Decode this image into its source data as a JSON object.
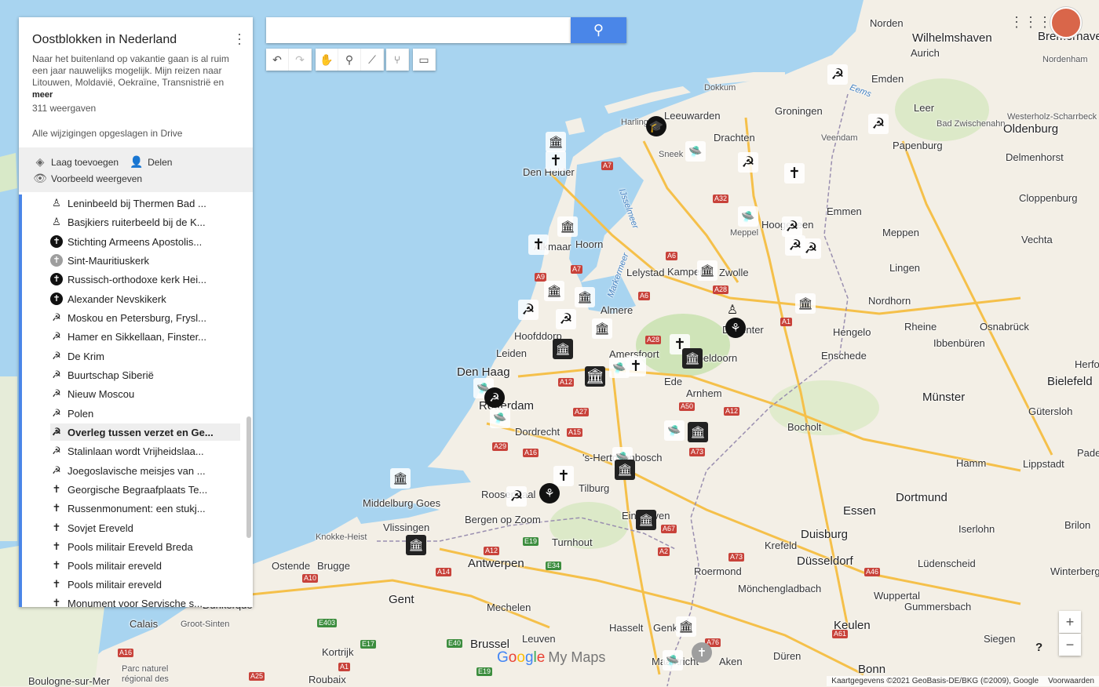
{
  "panel": {
    "title": "Oostblokken in Nederland",
    "description": "Naar het buitenland op vakantie gaan is al ruim een jaar nauwelijks mogelijk. Mijn reizen naar Litouwen, Moldavië, Oekraïne, Transnistrië en",
    "more": "meer",
    "views": "311 weergaven",
    "saved": "Alle wijzigingen opgeslagen in Drive",
    "add_layer": "Laag toevoegen",
    "share": "Delen",
    "preview": "Voorbeeld weergeven",
    "items": [
      {
        "label": "Leninbeeld bij Thermen Bad ...",
        "icon": "statue-icon"
      },
      {
        "label": "Basjkiers ruiterbeeld bij de K...",
        "icon": "statue-icon"
      },
      {
        "label": "Stichting Armeens Apostolis...",
        "icon": "church-cross-icon"
      },
      {
        "label": "Sint-Mauritiuskerk",
        "icon": "church-cross-grey-icon"
      },
      {
        "label": "Russisch-orthodoxe kerk Hei...",
        "icon": "church-cross-icon"
      },
      {
        "label": "Alexander Nevskikerk",
        "icon": "church-cross-icon"
      },
      {
        "label": "Moskou en Petersburg, Frysl...",
        "icon": "hammer-sickle-icon"
      },
      {
        "label": "Hamer en Sikkellaan, Finster...",
        "icon": "hammer-sickle-icon"
      },
      {
        "label": "De Krim",
        "icon": "hammer-sickle-icon"
      },
      {
        "label": "Buurtschap Siberië",
        "icon": "hammer-sickle-icon"
      },
      {
        "label": "Nieuw Moscou",
        "icon": "hammer-sickle-icon"
      },
      {
        "label": "Polen",
        "icon": "hammer-sickle-icon"
      },
      {
        "label": "Overleg tussen verzet en Ge...",
        "icon": "hammer-sickle-icon"
      },
      {
        "label": "Stalinlaan wordt Vrijheidslaa...",
        "icon": "hammer-sickle-icon"
      },
      {
        "label": "Joegoslavische meisjes van ...",
        "icon": "hammer-sickle-icon"
      },
      {
        "label": "Georgische Begraafplaats Te...",
        "icon": "cemetery-icon"
      },
      {
        "label": "Russenmonument: een stukj...",
        "icon": "cemetery-icon"
      },
      {
        "label": "Sovjet Ereveld",
        "icon": "cemetery-icon"
      },
      {
        "label": "Pools militair Ereveld Breda",
        "icon": "cemetery-icon"
      },
      {
        "label": "Pools militair ereveld",
        "icon": "cemetery-icon"
      },
      {
        "label": "Pools militair ereveld",
        "icon": "cemetery-icon"
      },
      {
        "label": "Monument voor Servische s...",
        "icon": "cemetery-icon"
      }
    ],
    "active_item": 12
  },
  "search": {
    "placeholder": "",
    "value": ""
  },
  "toolbar_icons": [
    "undo-icon",
    "redo-icon",
    "hand-icon",
    "marker-icon",
    "line-icon",
    "directions-icon",
    "ruler-icon"
  ],
  "colors": {
    "water": "#a8d4f0",
    "land": "#f3efe6",
    "accent": "#4a86e8",
    "motorway": "#f5c04a"
  },
  "places": [
    {
      "name": "Norden",
      "cls": ""
    },
    {
      "name": "Wilhelmshaven",
      "cls": "big"
    },
    {
      "name": "Bremerhaven",
      "cls": "big"
    },
    {
      "name": "Aurich",
      "cls": ""
    },
    {
      "name": "Nordenham",
      "cls": "small"
    },
    {
      "name": "Emden",
      "cls": ""
    },
    {
      "name": "Dokkum",
      "cls": "small"
    },
    {
      "name": "Leeuwarden",
      "cls": ""
    },
    {
      "name": "Groningen",
      "cls": ""
    },
    {
      "name": "Harlingen",
      "cls": "small"
    },
    {
      "name": "Leer",
      "cls": ""
    },
    {
      "name": "Westerholz-Scharrbeck",
      "cls": "small"
    },
    {
      "name": "Bad Zwischenahn",
      "cls": "small"
    },
    {
      "name": "Oldenburg",
      "cls": "big"
    },
    {
      "name": "Veendam",
      "cls": "small"
    },
    {
      "name": "Papenburg",
      "cls": ""
    },
    {
      "name": "Drachten",
      "cls": ""
    },
    {
      "name": "Sneek",
      "cls": "small"
    },
    {
      "name": "Den Helder",
      "cls": ""
    },
    {
      "name": "Delmenhorst",
      "cls": ""
    },
    {
      "name": "Emmen",
      "cls": ""
    },
    {
      "name": "Cloppenburg",
      "cls": ""
    },
    {
      "name": "Meppel",
      "cls": "small"
    },
    {
      "name": "Hoogeveen",
      "cls": ""
    },
    {
      "name": "Meppen",
      "cls": ""
    },
    {
      "name": "Vechta",
      "cls": ""
    },
    {
      "name": "Alkmaar",
      "cls": ""
    },
    {
      "name": "Hoorn",
      "cls": ""
    },
    {
      "name": "Lelystad",
      "cls": ""
    },
    {
      "name": "Kampen",
      "cls": ""
    },
    {
      "name": "Zwolle",
      "cls": ""
    },
    {
      "name": "Lingen",
      "cls": ""
    },
    {
      "name": "Nordhorn",
      "cls": ""
    },
    {
      "name": "Almere",
      "cls": ""
    },
    {
      "name": "Hoofddorp",
      "cls": ""
    },
    {
      "name": "Deventer",
      "cls": ""
    },
    {
      "name": "Rheine",
      "cls": ""
    },
    {
      "name": "Osnabrück",
      "cls": ""
    },
    {
      "name": "Hengelo",
      "cls": ""
    },
    {
      "name": "Leiden",
      "cls": ""
    },
    {
      "name": "Amersfoort",
      "cls": ""
    },
    {
      "name": "Apeldoorn",
      "cls": ""
    },
    {
      "name": "Ibbenbüren",
      "cls": ""
    },
    {
      "name": "Den Haag",
      "cls": "big"
    },
    {
      "name": "Enschede",
      "cls": ""
    },
    {
      "name": "Ede",
      "cls": ""
    },
    {
      "name": "Herford",
      "cls": ""
    },
    {
      "name": "Bielefeld",
      "cls": "big"
    },
    {
      "name": "Arnhem",
      "cls": ""
    },
    {
      "name": "Rotterdam",
      "cls": "big"
    },
    {
      "name": "Münster",
      "cls": "big"
    },
    {
      "name": "Gütersloh",
      "cls": ""
    },
    {
      "name": "Dordrecht",
      "cls": ""
    },
    {
      "name": "Bocholt",
      "cls": ""
    },
    {
      "name": "'s-Hertogenbosch",
      "cls": ""
    },
    {
      "name": "Hamm",
      "cls": ""
    },
    {
      "name": "Paderborn",
      "cls": ""
    },
    {
      "name": "Lippstadt",
      "cls": ""
    },
    {
      "name": "Middelburg",
      "cls": ""
    },
    {
      "name": "Goes",
      "cls": ""
    },
    {
      "name": "Roosendaal",
      "cls": ""
    },
    {
      "name": "Tilburg",
      "cls": ""
    },
    {
      "name": "Dortmund",
      "cls": "big"
    },
    {
      "name": "Essen",
      "cls": "big"
    },
    {
      "name": "Vlissingen",
      "cls": ""
    },
    {
      "name": "Bergen op Zoom",
      "cls": ""
    },
    {
      "name": "Eindhoven",
      "cls": ""
    },
    {
      "name": "Iserlohn",
      "cls": ""
    },
    {
      "name": "Brilon",
      "cls": ""
    },
    {
      "name": "Knokke-Heist",
      "cls": "small"
    },
    {
      "name": "Turnhout",
      "cls": ""
    },
    {
      "name": "Krefeld",
      "cls": ""
    },
    {
      "name": "Duisburg",
      "cls": "big"
    },
    {
      "name": "Antwerpen",
      "cls": "big"
    },
    {
      "name": "Ostende",
      "cls": ""
    },
    {
      "name": "Brugge",
      "cls": ""
    },
    {
      "name": "Roermond",
      "cls": ""
    },
    {
      "name": "Düsseldorf",
      "cls": "big"
    },
    {
      "name": "Lüdenscheid",
      "cls": ""
    },
    {
      "name": "Winterberg",
      "cls": ""
    },
    {
      "name": "Mönchengladbach",
      "cls": ""
    },
    {
      "name": "Dunkerque",
      "cls": ""
    },
    {
      "name": "Gent",
      "cls": "big"
    },
    {
      "name": "Mechelen",
      "cls": ""
    },
    {
      "name": "Wuppertal",
      "cls": ""
    },
    {
      "name": "Gummersbach",
      "cls": ""
    },
    {
      "name": "Calais",
      "cls": ""
    },
    {
      "name": "Groot-Sinten",
      "cls": "small"
    },
    {
      "name": "Hasselt",
      "cls": ""
    },
    {
      "name": "Genk",
      "cls": ""
    },
    {
      "name": "Keulen",
      "cls": "big"
    },
    {
      "name": "Leuven",
      "cls": ""
    },
    {
      "name": "Kortrijk",
      "cls": ""
    },
    {
      "name": "Siegen",
      "cls": ""
    },
    {
      "name": "Brussel",
      "cls": "big"
    },
    {
      "name": "Düren",
      "cls": ""
    },
    {
      "name": "Aken",
      "cls": ""
    },
    {
      "name": "Bonn",
      "cls": "big"
    },
    {
      "name": "Parc naturel régional des",
      "cls": "small"
    },
    {
      "name": "Boulogne-sur-Mer",
      "cls": ""
    },
    {
      "name": "Roubaix",
      "cls": ""
    },
    {
      "name": "Maastricht",
      "cls": ""
    }
  ],
  "water_labels": [
    "IJsselmeer",
    "Markermeer",
    "Eems"
  ],
  "roads": [
    "A7",
    "A32",
    "A6",
    "A9",
    "A7",
    "A6",
    "A28",
    "A28",
    "A1",
    "A12",
    "A27",
    "A15",
    "A50",
    "A12",
    "A29",
    "A16",
    "A73",
    "A2",
    "A67",
    "E19",
    "A12",
    "E34",
    "A10",
    "A14",
    "E40",
    "E17",
    "A16",
    "A1",
    "E19",
    "A25",
    "A73",
    "A61",
    "A76",
    "E403",
    "A46"
  ],
  "attribution": "Kaartgegevens ©2021 GeoBasis-DE/BKG (©2009), Google",
  "terms": "Voorwaarden",
  "logo": {
    "google": "Google",
    "product": "My Maps"
  },
  "zoom": {
    "in": "+",
    "out": "−"
  },
  "help": "?",
  "markers": [
    "hammer-sickle-icon",
    "museum-icon",
    "cross-icon",
    "ufo-icon",
    "graduation-icon",
    "statue-icon",
    "folk-dance-icon",
    "church-cross-icon"
  ]
}
